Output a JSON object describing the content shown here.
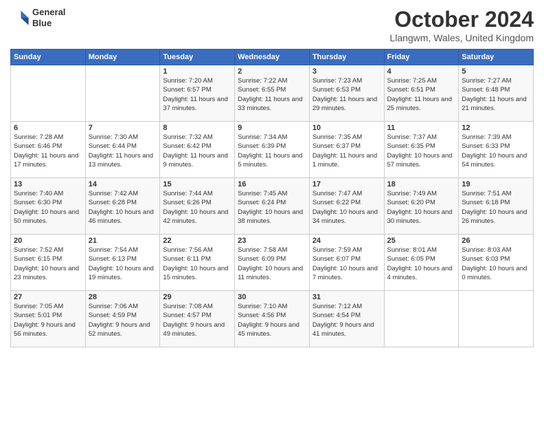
{
  "header": {
    "logo": {
      "line1": "General",
      "line2": "Blue"
    },
    "title": "October 2024",
    "location": "Llangwm, Wales, United Kingdom"
  },
  "weekdays": [
    "Sunday",
    "Monday",
    "Tuesday",
    "Wednesday",
    "Thursday",
    "Friday",
    "Saturday"
  ],
  "weeks": [
    [
      {
        "day": null
      },
      {
        "day": null
      },
      {
        "day": "1",
        "sunrise": "7:20 AM",
        "sunset": "6:57 PM",
        "daylight": "11 hours and 37 minutes."
      },
      {
        "day": "2",
        "sunrise": "7:22 AM",
        "sunset": "6:55 PM",
        "daylight": "11 hours and 33 minutes."
      },
      {
        "day": "3",
        "sunrise": "7:23 AM",
        "sunset": "6:53 PM",
        "daylight": "11 hours and 29 minutes."
      },
      {
        "day": "4",
        "sunrise": "7:25 AM",
        "sunset": "6:51 PM",
        "daylight": "11 hours and 25 minutes."
      },
      {
        "day": "5",
        "sunrise": "7:27 AM",
        "sunset": "6:48 PM",
        "daylight": "11 hours and 21 minutes."
      }
    ],
    [
      {
        "day": "6",
        "sunrise": "7:28 AM",
        "sunset": "6:46 PM",
        "daylight": "11 hours and 17 minutes."
      },
      {
        "day": "7",
        "sunrise": "7:30 AM",
        "sunset": "6:44 PM",
        "daylight": "11 hours and 13 minutes."
      },
      {
        "day": "8",
        "sunrise": "7:32 AM",
        "sunset": "6:42 PM",
        "daylight": "11 hours and 9 minutes."
      },
      {
        "day": "9",
        "sunrise": "7:34 AM",
        "sunset": "6:39 PM",
        "daylight": "11 hours and 5 minutes."
      },
      {
        "day": "10",
        "sunrise": "7:35 AM",
        "sunset": "6:37 PM",
        "daylight": "11 hours and 1 minute."
      },
      {
        "day": "11",
        "sunrise": "7:37 AM",
        "sunset": "6:35 PM",
        "daylight": "10 hours and 57 minutes."
      },
      {
        "day": "12",
        "sunrise": "7:39 AM",
        "sunset": "6:33 PM",
        "daylight": "10 hours and 54 minutes."
      }
    ],
    [
      {
        "day": "13",
        "sunrise": "7:40 AM",
        "sunset": "6:30 PM",
        "daylight": "10 hours and 50 minutes."
      },
      {
        "day": "14",
        "sunrise": "7:42 AM",
        "sunset": "6:28 PM",
        "daylight": "10 hours and 46 minutes."
      },
      {
        "day": "15",
        "sunrise": "7:44 AM",
        "sunset": "6:26 PM",
        "daylight": "10 hours and 42 minutes."
      },
      {
        "day": "16",
        "sunrise": "7:45 AM",
        "sunset": "6:24 PM",
        "daylight": "10 hours and 38 minutes."
      },
      {
        "day": "17",
        "sunrise": "7:47 AM",
        "sunset": "6:22 PM",
        "daylight": "10 hours and 34 minutes."
      },
      {
        "day": "18",
        "sunrise": "7:49 AM",
        "sunset": "6:20 PM",
        "daylight": "10 hours and 30 minutes."
      },
      {
        "day": "19",
        "sunrise": "7:51 AM",
        "sunset": "6:18 PM",
        "daylight": "10 hours and 26 minutes."
      }
    ],
    [
      {
        "day": "20",
        "sunrise": "7:52 AM",
        "sunset": "6:15 PM",
        "daylight": "10 hours and 23 minutes."
      },
      {
        "day": "21",
        "sunrise": "7:54 AM",
        "sunset": "6:13 PM",
        "daylight": "10 hours and 19 minutes."
      },
      {
        "day": "22",
        "sunrise": "7:56 AM",
        "sunset": "6:11 PM",
        "daylight": "10 hours and 15 minutes."
      },
      {
        "day": "23",
        "sunrise": "7:58 AM",
        "sunset": "6:09 PM",
        "daylight": "10 hours and 11 minutes."
      },
      {
        "day": "24",
        "sunrise": "7:59 AM",
        "sunset": "6:07 PM",
        "daylight": "10 hours and 7 minutes."
      },
      {
        "day": "25",
        "sunrise": "8:01 AM",
        "sunset": "6:05 PM",
        "daylight": "10 hours and 4 minutes."
      },
      {
        "day": "26",
        "sunrise": "8:03 AM",
        "sunset": "6:03 PM",
        "daylight": "10 hours and 0 minutes."
      }
    ],
    [
      {
        "day": "27",
        "sunrise": "7:05 AM",
        "sunset": "5:01 PM",
        "daylight": "9 hours and 56 minutes."
      },
      {
        "day": "28",
        "sunrise": "7:06 AM",
        "sunset": "4:59 PM",
        "daylight": "9 hours and 52 minutes."
      },
      {
        "day": "29",
        "sunrise": "7:08 AM",
        "sunset": "4:57 PM",
        "daylight": "9 hours and 49 minutes."
      },
      {
        "day": "30",
        "sunrise": "7:10 AM",
        "sunset": "4:56 PM",
        "daylight": "9 hours and 45 minutes."
      },
      {
        "day": "31",
        "sunrise": "7:12 AM",
        "sunset": "4:54 PM",
        "daylight": "9 hours and 41 minutes."
      },
      {
        "day": null
      },
      {
        "day": null
      }
    ]
  ],
  "labels": {
    "sunrise": "Sunrise:",
    "sunset": "Sunset:",
    "daylight": "Daylight:"
  }
}
